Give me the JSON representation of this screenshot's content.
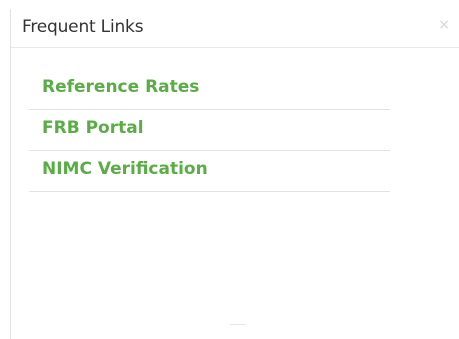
{
  "panel": {
    "title": "Frequent Links",
    "close_label": "×"
  },
  "links": [
    {
      "label": "Reference Rates"
    },
    {
      "label": "FRB Portal"
    },
    {
      "label": "NIMC Verification"
    }
  ],
  "colors": {
    "link": "#5aad45",
    "title": "#333333",
    "divider": "#e2e2e2"
  }
}
